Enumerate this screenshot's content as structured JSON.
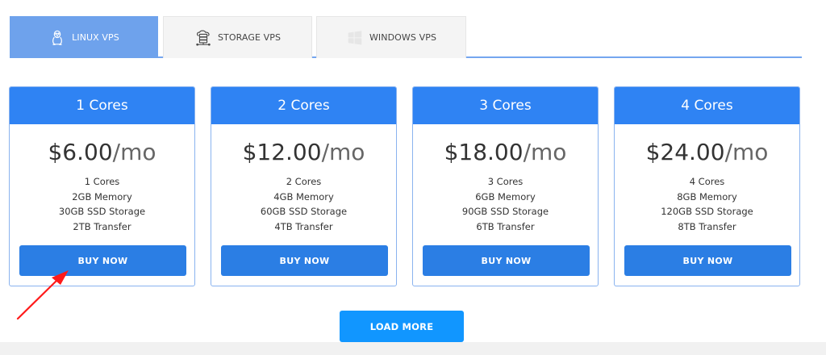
{
  "tabs": [
    {
      "label": "LINUX VPS",
      "icon": "linux-penguin-icon",
      "active": true
    },
    {
      "label": "STORAGE VPS",
      "icon": "storage-server-icon",
      "active": false
    },
    {
      "label": "WINDOWS VPS",
      "icon": "windows-logo-icon",
      "active": false
    }
  ],
  "plans": [
    {
      "title": "1 Cores",
      "price": "$6.00",
      "unit": "/mo",
      "features": [
        "1 Cores",
        "2GB Memory",
        "30GB SSD Storage",
        "2TB Transfer"
      ],
      "button": "BUY NOW"
    },
    {
      "title": "2 Cores",
      "price": "$12.00",
      "unit": "/mo",
      "features": [
        "2 Cores",
        "4GB Memory",
        "60GB SSD Storage",
        "4TB Transfer"
      ],
      "button": "BUY NOW"
    },
    {
      "title": "3 Cores",
      "price": "$18.00",
      "unit": "/mo",
      "features": [
        "3 Cores",
        "6GB Memory",
        "90GB SSD Storage",
        "6TB Transfer"
      ],
      "button": "BUY NOW"
    },
    {
      "title": "4 Cores",
      "price": "$24.00",
      "unit": "/mo",
      "features": [
        "4 Cores",
        "8GB Memory",
        "120GB SSD Storage",
        "8TB Transfer"
      ],
      "button": "BUY NOW"
    }
  ],
  "load_more": "LOAD MORE",
  "colors": {
    "accent": "#2f83f3",
    "button": "#2b7ee4",
    "load_more": "#1196ff",
    "tab_active": "#6ea2ec",
    "annotation_arrow": "#ff1a1a"
  }
}
